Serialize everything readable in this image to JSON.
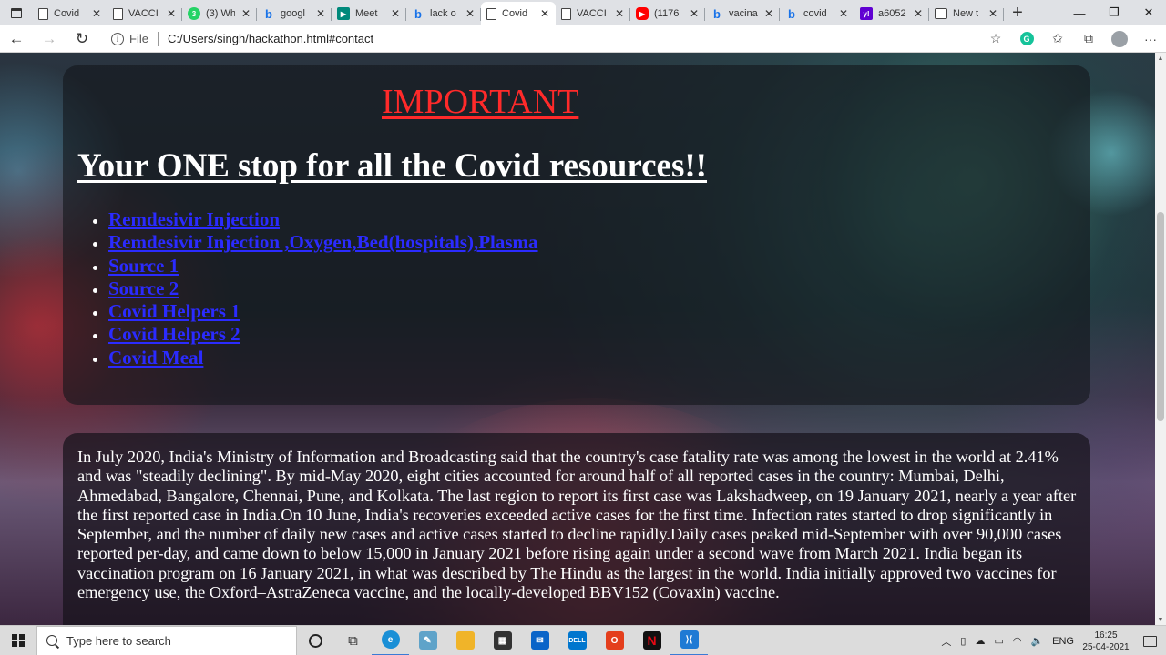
{
  "browser": {
    "tabs": [
      {
        "icon": "page-icon",
        "title": "Covid",
        "active": false
      },
      {
        "icon": "page-icon",
        "title": "VACCI",
        "active": false
      },
      {
        "icon": "whatsapp-icon",
        "title": "(3) Wh",
        "active": false
      },
      {
        "icon": "bing-icon",
        "title": "googl",
        "active": false
      },
      {
        "icon": "meet-icon",
        "title": "Meet",
        "active": false
      },
      {
        "icon": "bing-icon",
        "title": "lack o",
        "active": false
      },
      {
        "icon": "page-icon",
        "title": "Covid",
        "active": true
      },
      {
        "icon": "page-icon",
        "title": "VACCI",
        "active": false
      },
      {
        "icon": "youtube-icon",
        "title": "(1176",
        "active": false
      },
      {
        "icon": "bing-icon",
        "title": "vacina",
        "active": false
      },
      {
        "icon": "bing-icon",
        "title": "covid",
        "active": false
      },
      {
        "icon": "yahoo-icon",
        "title": "a6052",
        "active": false
      },
      {
        "icon": "newtab-icon",
        "title": "New t",
        "active": false
      }
    ],
    "address": {
      "scheme_label": "File",
      "url": "C:/Users/singh/hackathon.html#contact"
    }
  },
  "page": {
    "important_heading": "IMPORTANT",
    "headline": "Your ONE stop for all the Covid resources!!",
    "resource_links": [
      "Remdesivir Injection",
      "Remdesivir Injection ,Oxygen,Bed(hospitals),Plasma",
      "Source 1",
      "Source 2",
      "Covid Helpers 1",
      "Covid Helpers 2",
      "Covid Meal"
    ],
    "paragraph": "In July 2020, India's Ministry of Information and Broadcasting said that the country's case fatality rate was among the lowest in the world at 2.41% and was \"steadily declining\". By mid-May 2020, eight cities accounted for around half of all reported cases in the country: Mumbai, Delhi, Ahmedabad, Bangalore, Chennai, Pune, and Kolkata. The last region to report its first case was Lakshadweep, on 19 January 2021, nearly a year after the first reported case in India.On 10 June, India's recoveries exceeded active cases for the first time. Infection rates started to drop significantly in September, and the number of daily new cases and active cases started to decline rapidly.Daily cases peaked mid-September with over 90,000 cases reported per-day, and came down to below 15,000 in January 2021 before rising again under a second wave from March 2021. India began its vaccination program on 16 January 2021, in what was described by The Hindu as the largest in the world. India initially approved two vaccines for emergency use, the Oxford–AstraZeneca vaccine, and the locally-developed BBV152 (Covaxin) vaccine."
  },
  "taskbar": {
    "search_placeholder": "Type here to search",
    "language": "ENG",
    "time": "16:25",
    "date": "25-04-2021"
  },
  "colors": {
    "important": "#ff2a2a",
    "link": "#2b2bff",
    "text": "#ffffff"
  }
}
